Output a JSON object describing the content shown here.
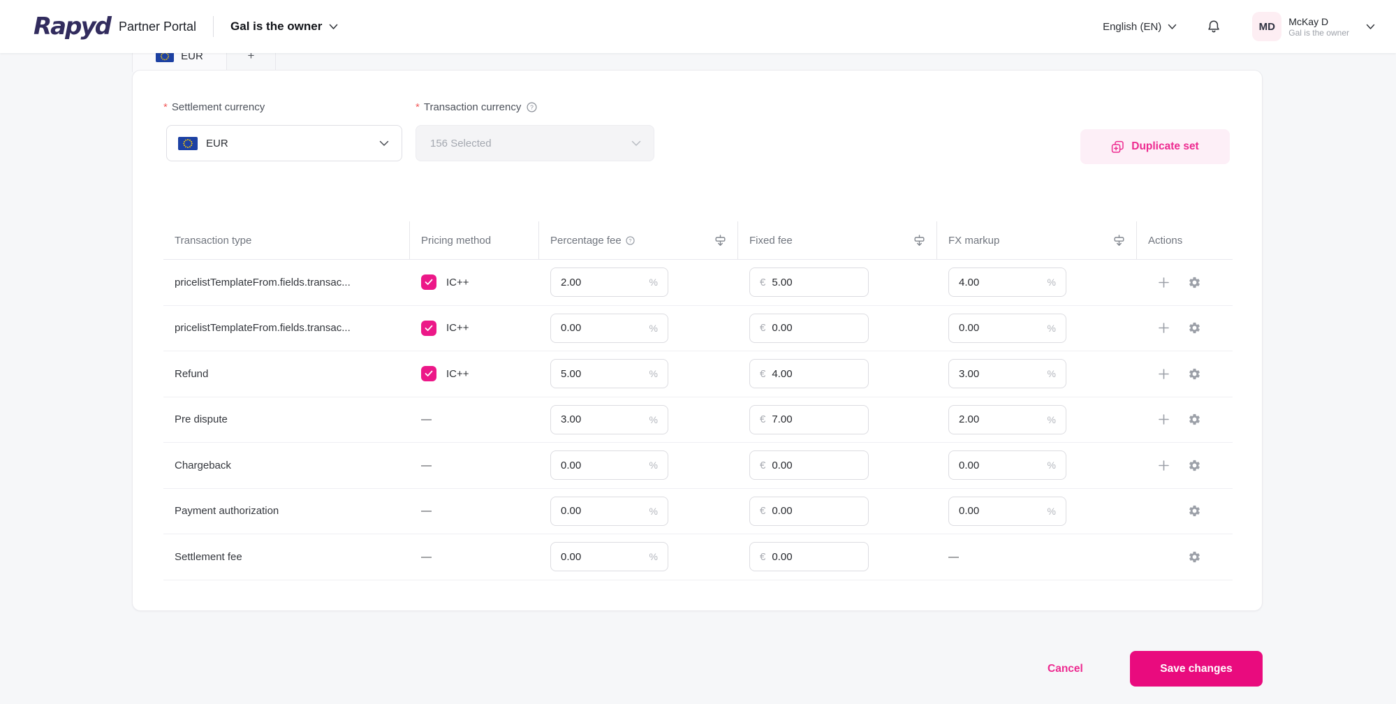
{
  "header": {
    "brand": "Rapyd",
    "product": "Partner Portal",
    "org_selector": "Gal is the owner",
    "language": "English (EN)",
    "user": {
      "initials": "MD",
      "name": "McKay D",
      "subtitle": "Gal is the owner"
    }
  },
  "tabs": {
    "active_label": "EUR",
    "add_label": "+"
  },
  "form": {
    "required_marker": "*",
    "settlement_currency": {
      "label": "Settlement currency",
      "value": "EUR"
    },
    "transaction_currency": {
      "label": "Transaction currency",
      "value": "156 Selected"
    },
    "duplicate_button_label": "Duplicate set"
  },
  "table": {
    "columns": [
      "Transaction type",
      "Pricing method",
      "Percentage fee",
      "Fixed fee",
      "FX markup",
      "Actions"
    ],
    "currency_symbol": "€",
    "percent_symbol": "%",
    "empty_value": "—",
    "rows": [
      {
        "name": "pricelistTemplateFrom.fields.transac...",
        "pricing_method": "IC++",
        "pricing_checked": true,
        "percentage_fee": "2.00",
        "fixed_fee": "5.00",
        "fx_markup": "4.00",
        "can_add": true
      },
      {
        "name": "pricelistTemplateFrom.fields.transac...",
        "pricing_method": "IC++",
        "pricing_checked": true,
        "percentage_fee": "0.00",
        "fixed_fee": "0.00",
        "fx_markup": "0.00",
        "can_add": true
      },
      {
        "name": "Refund",
        "pricing_method": "IC++",
        "pricing_checked": true,
        "percentage_fee": "5.00",
        "fixed_fee": "4.00",
        "fx_markup": "3.00",
        "can_add": true
      },
      {
        "name": "Pre dispute",
        "pricing_method": null,
        "pricing_checked": false,
        "percentage_fee": "3.00",
        "fixed_fee": "7.00",
        "fx_markup": "2.00",
        "can_add": true
      },
      {
        "name": "Chargeback",
        "pricing_method": null,
        "pricing_checked": false,
        "percentage_fee": "0.00",
        "fixed_fee": "0.00",
        "fx_markup": "0.00",
        "can_add": true
      },
      {
        "name": "Payment authorization",
        "pricing_method": null,
        "pricing_checked": false,
        "percentage_fee": "0.00",
        "fixed_fee": "0.00",
        "fx_markup": "0.00",
        "can_add": false
      },
      {
        "name": "Settlement fee",
        "pricing_method": null,
        "pricing_checked": false,
        "percentage_fee": "0.00",
        "fixed_fee": "0.00",
        "fx_markup": null,
        "can_add": false
      }
    ]
  },
  "footer": {
    "cancel_label": "Cancel",
    "save_label": "Save changes"
  },
  "colors": {
    "accent_pink": "#e90b7e",
    "accent_pink_light_bg": "#fdeff7",
    "checkbox_pink": "#ec1888",
    "logo_navy": "#322c5e",
    "page_background": "#f6f7f9",
    "eu_flag_blue": "#1d41a3",
    "eu_flag_stars": "#ffcc00"
  }
}
